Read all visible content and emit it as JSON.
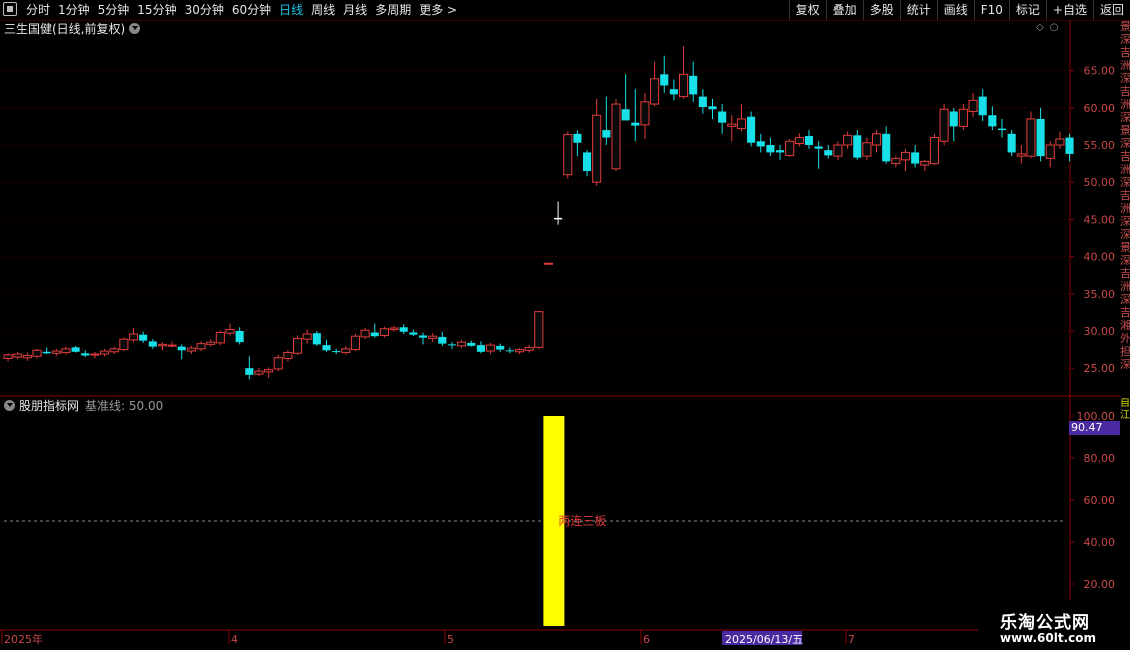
{
  "topbar": {
    "period_tabs": [
      "分时",
      "1分钟",
      "5分钟",
      "15分钟",
      "30分钟",
      "60分钟",
      "日线",
      "周线",
      "月线",
      "多周期",
      "更多 >"
    ],
    "active_tab": "日线",
    "tools": [
      "复权",
      "叠加",
      "多股",
      "统计",
      "画线",
      "F10",
      "标记",
      "+自选",
      "返回"
    ]
  },
  "stock": {
    "title": "三生国健(日线,前复权)"
  },
  "indicator": {
    "title": "股朋指标网",
    "baseline_label": "基准线: 50.00",
    "bar_label": "两连三板",
    "current_value_tag": "90.47"
  },
  "right_strip_text": "景深吉洲深吉洲深景深吉洲深吉洲深深景深吉洲深吉湘外担深",
  "side_mark": "自 江",
  "date_axis": {
    "labels": [
      "2025年",
      "4",
      "5",
      "6",
      "7"
    ],
    "highlight_date": "2025/06/13/五"
  },
  "watermark": {
    "site_name": "乐淘公式网",
    "url": "www.60lt.com"
  },
  "colors": {
    "up": "#e03c3c",
    "down": "#18e0e8",
    "bar": "#ffff00",
    "grid": "#5a0000",
    "axis_text": "#c84848"
  },
  "chart_data": [
    {
      "type": "candlestick",
      "title": "三生国健(日线,前复权)",
      "y_ticks": [
        25.0,
        30.0,
        35.0,
        40.0,
        45.0,
        50.0,
        55.0,
        60.0,
        65.0
      ],
      "ylim": [
        21.5,
        70.5
      ],
      "x_labels": [
        "2025年",
        "4",
        "5",
        "6",
        "7"
      ],
      "ohlc": [
        [
          26.3,
          27.0,
          25.9,
          26.8
        ],
        [
          26.5,
          27.2,
          26.2,
          26.9
        ],
        [
          26.4,
          27.1,
          26.0,
          26.7
        ],
        [
          26.6,
          27.6,
          26.3,
          27.4
        ],
        [
          27.2,
          27.8,
          26.9,
          27.0
        ],
        [
          27.0,
          27.6,
          26.6,
          27.3
        ],
        [
          27.1,
          27.9,
          26.8,
          27.6
        ],
        [
          27.8,
          28.0,
          27.1,
          27.2
        ],
        [
          27.0,
          27.4,
          26.5,
          26.7
        ],
        [
          26.8,
          27.2,
          26.3,
          26.9
        ],
        [
          26.9,
          27.6,
          26.6,
          27.3
        ],
        [
          27.2,
          27.9,
          26.9,
          27.6
        ],
        [
          27.5,
          29.1,
          27.3,
          28.9
        ],
        [
          28.8,
          30.4,
          28.5,
          29.6
        ],
        [
          29.5,
          29.9,
          28.4,
          28.7
        ],
        [
          28.6,
          28.9,
          27.6,
          27.9
        ],
        [
          28.0,
          28.5,
          27.4,
          28.2
        ],
        [
          28.1,
          28.6,
          27.8,
          28.1
        ],
        [
          27.9,
          28.2,
          26.2,
          27.4
        ],
        [
          27.3,
          28.0,
          26.9,
          27.7
        ],
        [
          27.6,
          28.6,
          27.3,
          28.3
        ],
        [
          28.2,
          28.9,
          27.9,
          28.5
        ],
        [
          28.4,
          30.1,
          28.1,
          29.8
        ],
        [
          29.7,
          31.0,
          29.4,
          30.2
        ],
        [
          30.0,
          30.5,
          28.2,
          28.5
        ],
        [
          25.0,
          26.6,
          23.5,
          24.1
        ],
        [
          24.2,
          25.0,
          23.9,
          24.6
        ],
        [
          24.5,
          25.1,
          23.7,
          24.8
        ],
        [
          24.9,
          26.8,
          24.6,
          26.4
        ],
        [
          26.3,
          27.4,
          25.9,
          27.1
        ],
        [
          27.0,
          29.4,
          26.8,
          29.0
        ],
        [
          28.9,
          30.2,
          28.3,
          29.6
        ],
        [
          29.7,
          30.0,
          28.0,
          28.2
        ],
        [
          28.1,
          28.8,
          27.2,
          27.4
        ],
        [
          27.3,
          27.6,
          26.9,
          27.2
        ],
        [
          27.1,
          28.0,
          26.8,
          27.6
        ],
        [
          27.5,
          29.6,
          27.3,
          29.3
        ],
        [
          29.2,
          30.4,
          28.9,
          30.1
        ],
        [
          29.8,
          31.0,
          29.1,
          29.3
        ],
        [
          29.4,
          30.6,
          29.1,
          30.3
        ],
        [
          30.2,
          30.7,
          29.9,
          30.4
        ],
        [
          30.5,
          30.9,
          29.6,
          29.9
        ],
        [
          29.8,
          30.2,
          29.3,
          29.5
        ],
        [
          29.4,
          29.8,
          28.2,
          29.1
        ],
        [
          29.0,
          29.7,
          28.5,
          29.3
        ],
        [
          29.2,
          29.9,
          28.0,
          28.3
        ],
        [
          28.2,
          28.5,
          27.6,
          28.1
        ],
        [
          28.0,
          28.8,
          27.7,
          28.5
        ],
        [
          28.4,
          28.7,
          27.9,
          28.0
        ],
        [
          28.1,
          28.6,
          27.0,
          27.2
        ],
        [
          27.3,
          28.4,
          26.9,
          28.1
        ],
        [
          28.0,
          28.3,
          27.2,
          27.5
        ],
        [
          27.4,
          27.8,
          27.0,
          27.3
        ],
        [
          27.2,
          27.7,
          26.9,
          27.5
        ],
        [
          27.4,
          28.1,
          27.1,
          27.8
        ],
        [
          27.8,
          32.7,
          27.6,
          32.6
        ],
        [
          39.1,
          39.2,
          39.0,
          39.1
        ],
        [
          45.0,
          47.4,
          44.3,
          45.2
        ],
        [
          51.0,
          56.8,
          50.5,
          56.4
        ],
        [
          56.5,
          57.0,
          53.5,
          55.3
        ],
        [
          54.0,
          54.3,
          50.8,
          51.5
        ],
        [
          50.0,
          61.2,
          49.5,
          59.0
        ],
        [
          57.0,
          61.5,
          55.0,
          56.0
        ],
        [
          51.8,
          61.2,
          51.5,
          60.5
        ],
        [
          59.8,
          64.5,
          59.1,
          58.3
        ],
        [
          58.0,
          62.5,
          55.5,
          57.6
        ],
        [
          57.7,
          62.0,
          55.8,
          60.8
        ],
        [
          60.5,
          66.2,
          60.2,
          63.9
        ],
        [
          64.5,
          67.0,
          62.0,
          63.0
        ],
        [
          62.5,
          63.8,
          61.0,
          61.8
        ],
        [
          61.5,
          68.3,
          61.2,
          64.5
        ],
        [
          64.3,
          66.2,
          60.8,
          61.8
        ],
        [
          61.5,
          62.5,
          59.2,
          60.1
        ],
        [
          60.2,
          61.2,
          58.5,
          59.8
        ],
        [
          59.5,
          60.5,
          56.5,
          58.0
        ],
        [
          57.5,
          59.0,
          55.5,
          57.8
        ],
        [
          57.2,
          60.5,
          56.8,
          58.5
        ],
        [
          58.8,
          59.5,
          54.8,
          55.3
        ],
        [
          55.5,
          56.5,
          54.0,
          54.8
        ],
        [
          55.0,
          56.0,
          53.5,
          54.0
        ],
        [
          54.3,
          55.0,
          53.0,
          54.0
        ],
        [
          53.6,
          55.8,
          53.4,
          55.5
        ],
        [
          55.2,
          56.6,
          54.8,
          56.0
        ],
        [
          56.2,
          57.0,
          54.5,
          55.0
        ],
        [
          54.8,
          55.5,
          51.8,
          54.5
        ],
        [
          54.3,
          55.0,
          53.2,
          53.6
        ],
        [
          53.5,
          55.5,
          53.0,
          55.0
        ],
        [
          55.0,
          56.8,
          54.5,
          56.3
        ],
        [
          56.3,
          57.0,
          53.0,
          53.3
        ],
        [
          53.5,
          56.0,
          53.0,
          55.3
        ],
        [
          55.0,
          57.0,
          54.0,
          56.5
        ],
        [
          56.5,
          57.5,
          52.5,
          52.8
        ],
        [
          52.5,
          53.5,
          52.0,
          53.2
        ],
        [
          53.0,
          54.5,
          51.5,
          54.0
        ],
        [
          54.0,
          55.0,
          52.0,
          52.5
        ],
        [
          52.3,
          53.0,
          51.5,
          52.8
        ],
        [
          52.5,
          56.5,
          52.3,
          56.0
        ],
        [
          55.5,
          60.5,
          55.0,
          59.8
        ],
        [
          59.5,
          60.0,
          55.5,
          57.5
        ],
        [
          57.5,
          60.5,
          57.0,
          59.8
        ],
        [
          59.5,
          62.0,
          58.8,
          61.0
        ],
        [
          61.5,
          62.5,
          58.2,
          59.0
        ],
        [
          59.0,
          60.2,
          57.0,
          57.5
        ],
        [
          57.2,
          58.5,
          56.0,
          57.0
        ],
        [
          56.5,
          57.0,
          53.5,
          54.0
        ],
        [
          53.5,
          55.0,
          52.5,
          53.8
        ],
        [
          53.5,
          59.5,
          53.2,
          58.5
        ],
        [
          58.5,
          60.0,
          52.8,
          53.5
        ],
        [
          53.2,
          55.5,
          52.0,
          55.0
        ],
        [
          55.0,
          56.8,
          54.5,
          55.8
        ],
        [
          56.0,
          56.5,
          52.8,
          53.8
        ]
      ]
    },
    {
      "type": "bar",
      "title": "股朋指标网",
      "y_ticks": [
        20.0,
        40.0,
        60.0,
        80.0,
        100.0
      ],
      "ylim": [
        0,
        102
      ],
      "baseline": 50.0,
      "bars": [
        {
          "index": 56,
          "value": 100.0,
          "label": "两连三板"
        }
      ]
    }
  ]
}
